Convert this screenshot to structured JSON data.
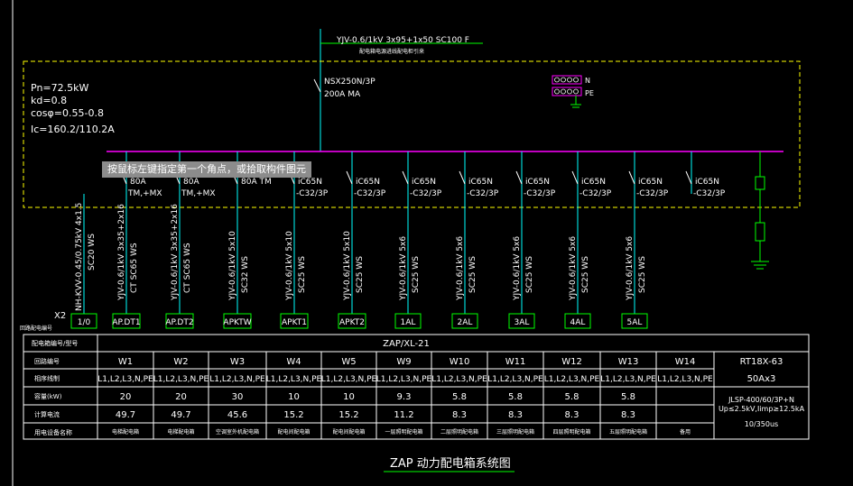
{
  "side_marks": [
    "Ⓘ",
    "Ⓘ",
    "Ⓘ"
  ],
  "tooltip": "按鼠标左键指定第一个角点，或拾取构件图元",
  "incoming": {
    "cable": "YJV-0.6/1kV 3x95+1x50 SC100 F",
    "note": "配电箱电源进线配电柜引来",
    "breaker": "NSX250N/3P",
    "rating": "200A MA"
  },
  "params": [
    "Pn=72.5kW",
    "kd=0.8",
    "cosφ=0.55-0.8",
    "Ic=160.2/110.2A"
  ],
  "bus_labels": [
    "N",
    "PE"
  ],
  "colors": {
    "frame": "#ffff00",
    "bus": "#ff00ff",
    "feeder": "#00ffff",
    "box": "#00ff00",
    "text": "#ffffff"
  },
  "feeders": [
    {
      "breaker": "",
      "setting": "",
      "cable": "NH-KVV-0.45/0.75kV 4x1.5",
      "conduit": "SC20 WS",
      "box": "1/0"
    },
    {
      "breaker": "80A",
      "setting": "TM,+MX",
      "cable": "YJV-0.6/1kV 3x35+2x16",
      "conduit": "CT SC65 WS",
      "box": "AP.DT1"
    },
    {
      "breaker": "80A",
      "setting": "TM,+MX",
      "cable": "YJV-0.6/1kV 3x35+2x16",
      "conduit": "CT SC65 WS",
      "box": "AP.DT2"
    },
    {
      "breaker": "80A TM",
      "setting": "",
      "cable": "YJV-0.6/1kV 5x10",
      "conduit": "SC32 WS",
      "box": "APKTW"
    },
    {
      "breaker": "iC65N",
      "setting": "-C32/3P",
      "cable": "YJV-0.6/1kV 5x10",
      "conduit": "SC25 WS",
      "box": "APKT1"
    },
    {
      "breaker": "iC65N",
      "setting": "-C32/3P",
      "cable": "YJV-0.6/1kV 5x10",
      "conduit": "SC25 WS",
      "box": "APKT2"
    },
    {
      "breaker": "iC65N",
      "setting": "-C32/3P",
      "cable": "YJV-0.6/1kV 5x6",
      "conduit": "SC25 WS",
      "box": "1AL"
    },
    {
      "breaker": "iC65N",
      "setting": "-C32/3P",
      "cable": "YJV-0.6/1kV 5x6",
      "conduit": "SC25 WS",
      "box": "2AL"
    },
    {
      "breaker": "iC65N",
      "setting": "-C32/3P",
      "cable": "YJV-0.6/1kV 5x6",
      "conduit": "SC25 WS",
      "box": "3AL"
    },
    {
      "breaker": "iC65N",
      "setting": "-C32/3P",
      "cable": "YJV-0.6/1kV 5x6",
      "conduit": "SC25 WS",
      "box": "4AL"
    },
    {
      "breaker": "iC65N",
      "setting": "-C32/3P",
      "cable": "YJV-0.6/1kV 5x6",
      "conduit": "SC25 WS",
      "box": "5AL"
    },
    {
      "breaker": "iC65N",
      "setting": "-C32/3P",
      "cable": "",
      "conduit": "",
      "box": ""
    }
  ],
  "x2_label": "X2",
  "table": {
    "box_label": "配电箱编号/型号",
    "box_value": "ZAP/XL-21",
    "left_top": "回路配电编号",
    "row_headers": [
      "回路编号",
      "相序线制",
      "容量(kW)",
      "计算电流",
      "用电设备名称"
    ],
    "columns": [
      "W1",
      "W2",
      "W3",
      "W4",
      "W5",
      "W9",
      "W10",
      "W11",
      "W12",
      "W13",
      "W14"
    ],
    "phase": [
      "L1,L2,L3,N,PE",
      "L1,L2,L3,N,PE",
      "L1,L2,L3,N,PE",
      "L1,L2,L3,N,PE",
      "L1,L2,L3,N,PE",
      "L1,L2,L3,N,PE",
      "L1,L2,L3,N,PE",
      "L1,L2,L3,N,PE",
      "L1,L2,L3,N,PE",
      "L1,L2,L3,N,PE",
      "L1,L2,L3,N,PE"
    ],
    "capacity": [
      "20",
      "20",
      "30",
      "10",
      "10",
      "9.3",
      "5.8",
      "5.8",
      "5.8",
      "5.8",
      ""
    ],
    "current": [
      "49.7",
      "49.7",
      "45.6",
      "15.2",
      "15.2",
      "11.2",
      "8.3",
      "8.3",
      "8.3",
      "8.3",
      ""
    ],
    "names": [
      "电梯配电箱",
      "电梯配电箱",
      "空调室外机配电箱",
      "配电间配电箱",
      "配电间配电箱",
      "一层照明配电箱",
      "二层照明配电箱",
      "三层照明配电箱",
      "四层照明配电箱",
      "五层照明配电箱",
      "备用"
    ],
    "right": [
      "RT18X-63",
      "50Ax3",
      "JLSP-400/60/3P+N",
      "Up≤2.5kV,Iimp≥12.5kA",
      "10/350us"
    ]
  },
  "drawing_title": "ZAP 动力配电箱系统图"
}
